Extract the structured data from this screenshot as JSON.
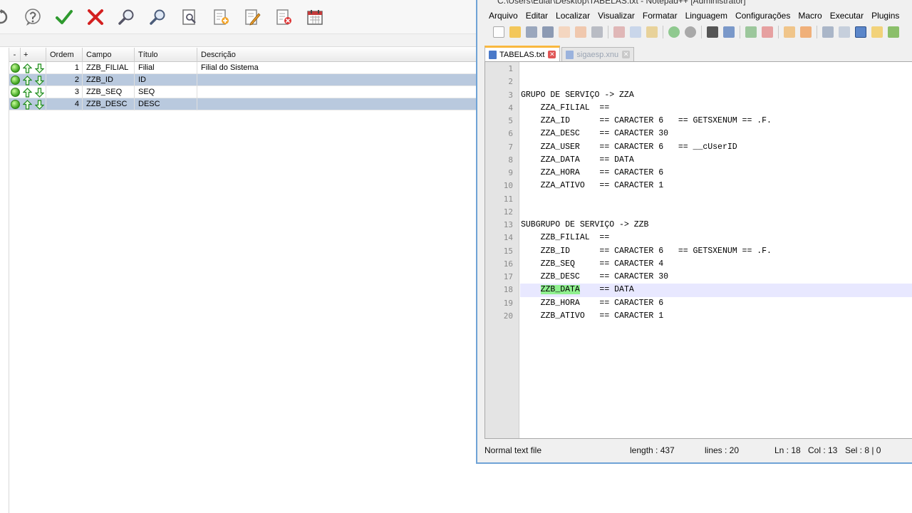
{
  "left_app": {
    "grid": {
      "headers": [
        "-",
        "+",
        "Ordem",
        "Campo",
        "Título",
        "Descrição"
      ],
      "rows": [
        {
          "ordem": "1",
          "campo": "ZZB_FILIAL",
          "titulo": "Filial",
          "descricao": "Filial do Sistema",
          "selected": false
        },
        {
          "ordem": "2",
          "campo": "ZZB_ID",
          "titulo": "ID",
          "descricao": "",
          "selected": true
        },
        {
          "ordem": "3",
          "campo": "ZZB_SEQ",
          "titulo": "SEQ",
          "descricao": "",
          "selected": false
        },
        {
          "ordem": "4",
          "campo": "ZZB_DESC",
          "titulo": "DESC",
          "descricao": "",
          "selected": true
        }
      ]
    },
    "toolbar_icons": [
      "refresh-icon",
      "help-icon",
      "confirm-check-icon",
      "cancel-x-icon",
      "search-icon",
      "search-next-icon",
      "preview-icon",
      "add-document-icon",
      "edit-document-icon",
      "delete-document-icon",
      "calendar-icon"
    ],
    "colors": {
      "confirm": "#2f9a2f",
      "cancel": "#d42020",
      "selection": "#b9c9de",
      "status_ok": "#3ca11e"
    }
  },
  "npp": {
    "title": "C:\\Users\\Eular\\Desktop\\TABELAS.txt - Notepad++ [Administrator]",
    "menu": [
      "Arquivo",
      "Editar",
      "Localizar",
      "Visualizar",
      "Formatar",
      "Linguagem",
      "Configurações",
      "Macro",
      "Executar",
      "Plugins"
    ],
    "tabs": [
      {
        "label": "TABELAS.txt",
        "active": true
      },
      {
        "label": "sigaesp.xnu",
        "active": false
      }
    ],
    "lines": [
      "",
      "",
      "GRUPO DE SERVIÇO -> ZZA",
      "    ZZA_FILIAL  ==",
      "    ZZA_ID      == CARACTER 6   == GETSXENUM == .F.",
      "    ZZA_DESC    == CARACTER 30",
      "    ZZA_USER    == CARACTER 6   == __cUserID",
      "    ZZA_DATA    == DATA",
      "    ZZA_HORA    == CARACTER 6",
      "    ZZA_ATIVO   == CARACTER 1",
      "",
      "",
      "SUBGRUPO DE SERVIÇO -> ZZB",
      "    ZZB_FILIAL  ==",
      "    ZZB_ID      == CARACTER 6   == GETSXENUM == .F.",
      "    ZZB_SEQ     == CARACTER 4",
      "    ZZB_DESC    == CARACTER 30",
      "    ZZB_DATA    == DATA",
      "    ZZB_HORA    == CARACTER 6",
      "    ZZB_ATIVO   == CARACTER 1"
    ],
    "current_line": 18,
    "selection_text": "ZZB_DATA",
    "status": {
      "type": "Normal text file",
      "length": "length : 437",
      "lines": "lines : 20",
      "ln": "Ln : 18",
      "col": "Col : 13",
      "sel": "Sel : 8 | 0"
    }
  }
}
